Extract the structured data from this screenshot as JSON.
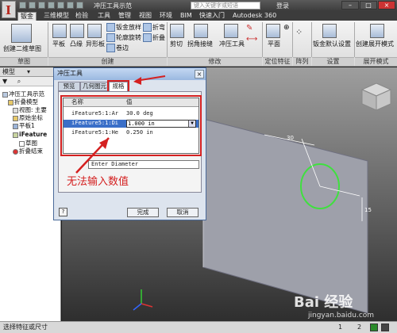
{
  "window": {
    "title": "冲压工具示范",
    "search_placeholder": "键入关键字或短语",
    "login_label": "登录"
  },
  "ribbon_tabs": [
    "钣金",
    "三维模型",
    "检验",
    "工具",
    "管理",
    "视图",
    "环境",
    "BIM",
    "快速入门",
    "Autodesk 360"
  ],
  "ribbon": {
    "sketch_btn": "创建二维草图",
    "sketch_group": "草图",
    "create_group": "创建",
    "create_items": [
      "平板",
      "凸缘",
      "异形板"
    ],
    "create_small": [
      "钣金放样",
      "轮廓旋转",
      "卷边",
      "折弯",
      "折叠"
    ],
    "modify_items": [
      "剪切",
      "拐角接缝",
      "冲压工具"
    ],
    "modify_group": "修改",
    "position_group": "定位特征",
    "plane_label": "平面",
    "array_group": "阵列",
    "settings_btn": "钣金默认设置",
    "settings_group": "设置",
    "flat_btn": "创建展开模式",
    "flat_group": "展开模式"
  },
  "browser": {
    "header": "模型",
    "items": [
      "冲压工具示范",
      "折叠模型",
      "视图: 主要",
      "原始坐标",
      "平板1",
      "iFeature",
      "草图",
      "折叠结束"
    ]
  },
  "dialog": {
    "title": "冲压工具",
    "tabs": [
      "预览",
      "几何图元",
      "规格"
    ],
    "columns": [
      "名称",
      "值"
    ],
    "rows": [
      {
        "name": "iFeature5:1:Ar",
        "value": "30.0 deg"
      },
      {
        "name": "iFeature5:1:Di",
        "value": "1.000 in"
      },
      {
        "name": "iFeature5:1:He",
        "value": "0.250 in"
      }
    ],
    "description": "Enter Diameter",
    "ok_label": "完成",
    "cancel_label": "取消",
    "help_label": "?"
  },
  "annotation": "无法输入数值",
  "viewport": {
    "dim_top": "30",
    "dim_side": "15"
  },
  "statusbar": {
    "message": "选择特征或尺寸",
    "page_1": "1",
    "page_2": "2"
  },
  "watermark": {
    "brand": "Bai 经验",
    "url": "jingyan.baidu.com"
  },
  "colors": {
    "highlight_red": "#d42020",
    "selection_blue": "#3a6fc8",
    "circle_green": "#3fe03f"
  }
}
